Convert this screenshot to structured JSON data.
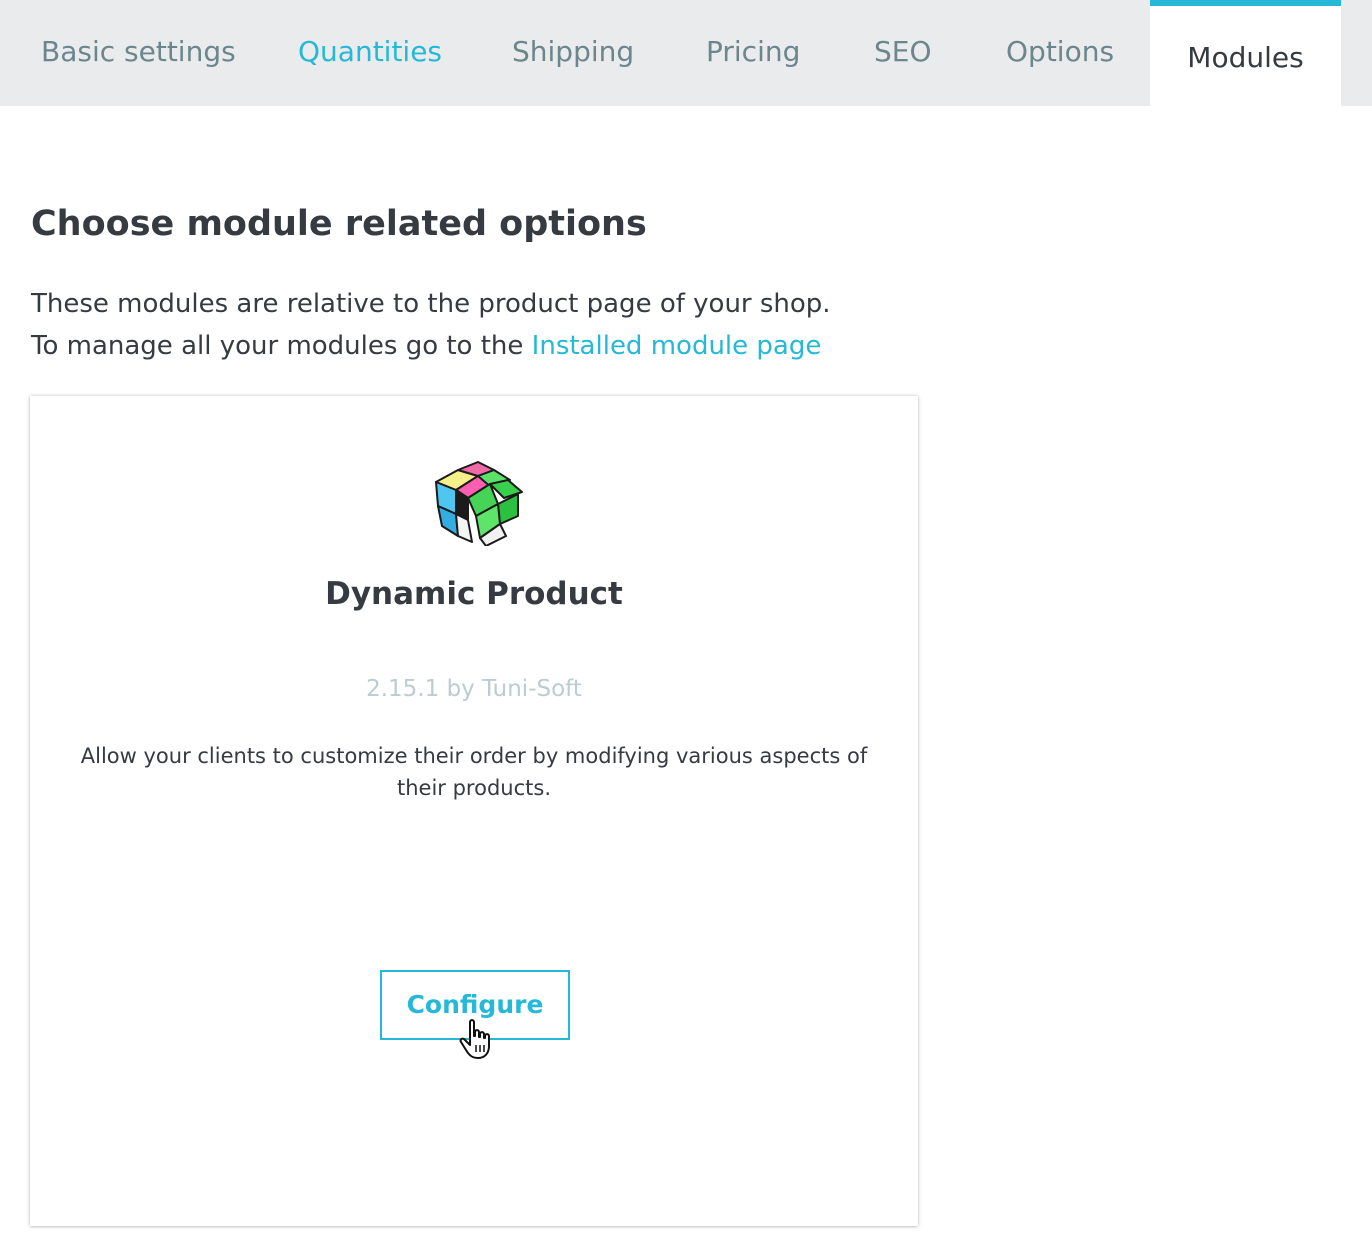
{
  "tabs": [
    {
      "label": "Basic settings",
      "state": "normal"
    },
    {
      "label": "Quantities",
      "state": "highlight"
    },
    {
      "label": "Shipping",
      "state": "normal"
    },
    {
      "label": "Pricing",
      "state": "normal"
    },
    {
      "label": "SEO",
      "state": "normal"
    },
    {
      "label": "Options",
      "state": "normal"
    },
    {
      "label": "Modules",
      "state": "active"
    }
  ],
  "content": {
    "heading": "Choose module related options",
    "intro_line1": "These modules are relative to the product page of your shop.",
    "intro_line2_prefix": "To manage all your modules go to the ",
    "intro_link": "Installed module page"
  },
  "module": {
    "icon": "rubiks-cube-icon",
    "name": "Dynamic Product",
    "meta": "2.15.1 by Tuni-Soft",
    "description": "Allow your clients to customize their order by modifying various aspects of their products.",
    "configure_label": "Configure"
  },
  "colors": {
    "accent": "#25b9d7",
    "tabbar_bg": "#eaebec",
    "tab_text": "#6c868e",
    "text": "#363a41",
    "muted": "#bbcdd2"
  }
}
